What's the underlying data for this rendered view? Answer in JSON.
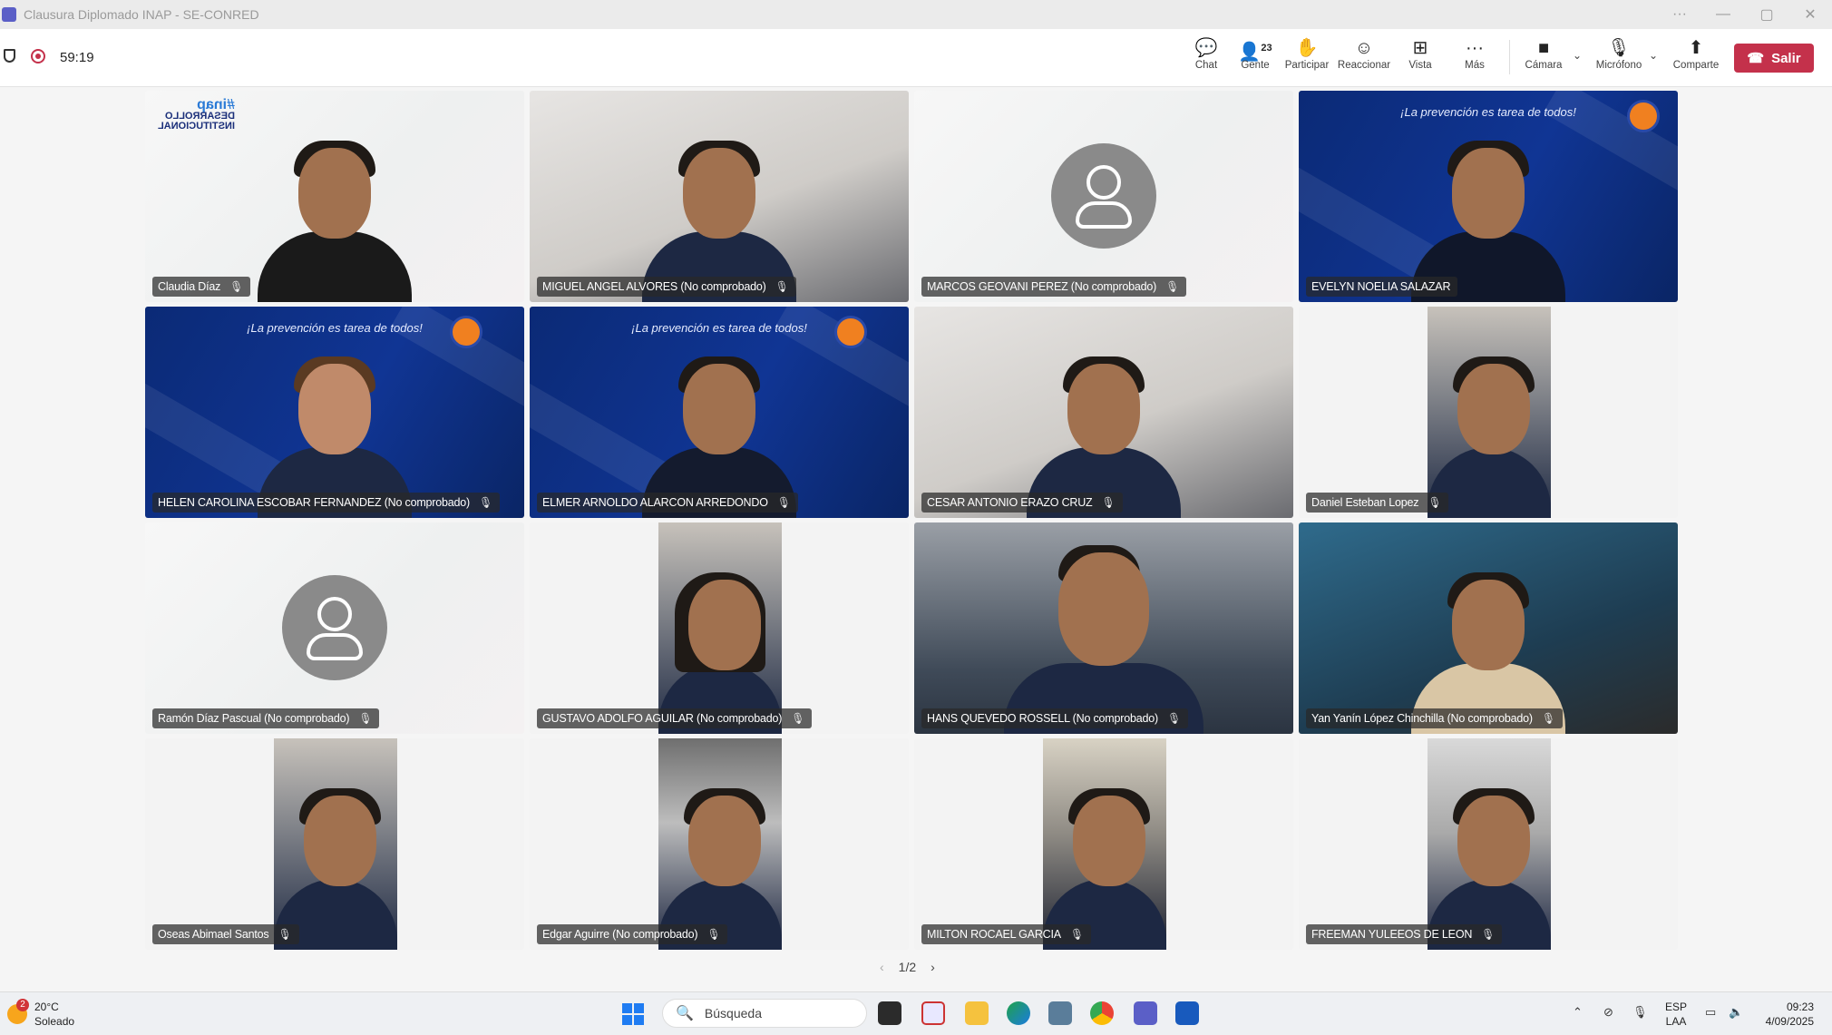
{
  "window": {
    "title": "Clausura Diplomado INAP - SE-CONRED",
    "controls": [
      "···",
      "—",
      "▢",
      "✕"
    ]
  },
  "meeting": {
    "elapsed": "59:19",
    "toolbar": {
      "chat": "Chat",
      "people": "Gente",
      "people_count": "23",
      "participate": "Participar",
      "react": "Reaccionar",
      "view": "Vista",
      "more": "Más",
      "camera": "Cámara",
      "mic": "Micrófono",
      "share": "Comparte",
      "leave": "Salir"
    },
    "participants": [
      {
        "name": "Claudia Díaz",
        "mic": "muted",
        "style": "inap"
      },
      {
        "name": "MIGUEL ANGEL ALVORES (No comprobado)",
        "mic": "muted",
        "style": "office"
      },
      {
        "name": "MARCOS GEOVANI PEREZ (No comprobado)",
        "mic": "muted",
        "style": "avatar"
      },
      {
        "name": "EVELYN NOELIA SALAZAR",
        "mic": "unmuted",
        "style": "blue"
      },
      {
        "name": "HELEN CAROLINA ESCOBAR FERNANDEZ (No comprobado)",
        "mic": "muted",
        "style": "blue"
      },
      {
        "name": "ELMER ARNOLDO ALARCON ARREDONDO",
        "mic": "muted",
        "style": "blue"
      },
      {
        "name": "CESAR ANTONIO ERAZO CRUZ",
        "mic": "muted",
        "style": "office"
      },
      {
        "name": "Daniel Esteban Lopez",
        "mic": "muted",
        "style": "narrow"
      },
      {
        "name": "Ramón Díaz Pascual (No comprobado)",
        "mic": "muted",
        "style": "avatar"
      },
      {
        "name": "GUSTAVO ADOLFO AGUILAR (No comprobado)",
        "mic": "muted",
        "style": "narrow"
      },
      {
        "name": "HANS QUEVEDO ROSSELL (No comprobado)",
        "mic": "muted",
        "style": "office"
      },
      {
        "name": "Yan Yanín López Chinchilla (No comprobado)",
        "mic": "muted",
        "style": "dim"
      },
      {
        "name": "Oseas Abimael Santos",
        "mic": "muted",
        "style": "narrow"
      },
      {
        "name": "Edgar Aguirre (No comprobado)",
        "mic": "muted",
        "style": "narrow"
      },
      {
        "name": "MILTON ROCAEL GARCIA",
        "mic": "muted",
        "style": "narrow"
      },
      {
        "name": "FREEMAN YULEEOS DE LEON",
        "mic": "muted",
        "style": "narrow"
      }
    ],
    "background_slogan": "¡La prevención es tarea de todos!",
    "inap_logo": {
      "tag": "#",
      "brand": "inap",
      "line1": "DESARROLLO",
      "line2": "INSTITUCIONAL"
    },
    "pager": "1/2"
  },
  "taskbar": {
    "weather_temp": "20°C",
    "weather_desc": "Soleado",
    "weather_badge": "2",
    "search_placeholder": "Búsqueda",
    "lang1": "ESP",
    "lang2": "LAA",
    "time": "09:23",
    "date": "4/09/2025"
  }
}
